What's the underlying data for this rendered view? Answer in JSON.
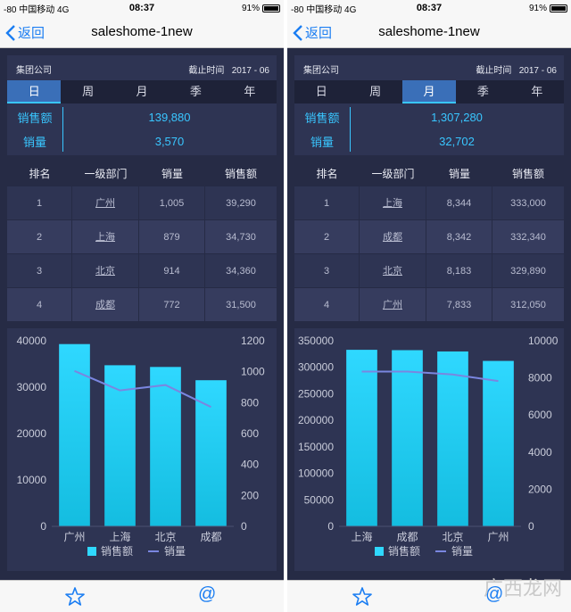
{
  "status_bar": {
    "carrier": "-80 中国移动",
    "network": "4G",
    "time": "08:37",
    "battery": "91%"
  },
  "nav": {
    "back_label": "返回",
    "title": "saleshome-1new"
  },
  "header": {
    "company": "集团公司",
    "deadline_label": "截止时间",
    "deadline_value": "2017 - 06"
  },
  "tabs": [
    "日",
    "周",
    "月",
    "季",
    "年"
  ],
  "metric_labels": {
    "sales_amount": "销售额",
    "sales_volume": "销量"
  },
  "table_headers": [
    "排名",
    "一级部门",
    "销量",
    "销售额"
  ],
  "legend": {
    "bar": "销售额",
    "line": "销量"
  },
  "colors": {
    "background": "#262b45",
    "card": "#2e3453",
    "accent": "#39c6ff",
    "active_tab": "#3a6fb8",
    "line": "#7a86e0"
  },
  "icons": {
    "back": "chevron-left-icon",
    "favorite": "star-icon",
    "mention": "at-icon"
  },
  "panels": [
    {
      "active_tab": "日",
      "sales_amount": "139,880",
      "sales_volume": "3,570",
      "rows": [
        {
          "rank": "1",
          "dept": "广州",
          "volume": "1,005",
          "amount": "39,290"
        },
        {
          "rank": "2",
          "dept": "上海",
          "volume": "879",
          "amount": "34,730"
        },
        {
          "rank": "3",
          "dept": "北京",
          "volume": "914",
          "amount": "34,360"
        },
        {
          "rank": "4",
          "dept": "成都",
          "volume": "772",
          "amount": "31,500"
        }
      ],
      "chart_data": {
        "type": "bar",
        "categories": [
          "广州",
          "上海",
          "北京",
          "成都"
        ],
        "series": [
          {
            "name": "销售额",
            "type": "bar",
            "axis": "left",
            "values": [
              39290,
              34730,
              34360,
              31500
            ]
          },
          {
            "name": "销量",
            "type": "line",
            "axis": "right",
            "values": [
              1005,
              879,
              914,
              772
            ]
          }
        ],
        "y_left": {
          "min": 0,
          "max": 40000,
          "ticks": [
            "0",
            "10000",
            "20000",
            "30000",
            "40000"
          ]
        },
        "y_right": {
          "min": 0,
          "max": 1200,
          "ticks": [
            "0",
            "200",
            "400",
            "600",
            "800",
            "1000",
            "1200"
          ]
        },
        "legend_position": "bottom"
      }
    },
    {
      "active_tab": "月",
      "sales_amount": "1,307,280",
      "sales_volume": "32,702",
      "rows": [
        {
          "rank": "1",
          "dept": "上海",
          "volume": "8,344",
          "amount": "333,000"
        },
        {
          "rank": "2",
          "dept": "成都",
          "volume": "8,342",
          "amount": "332,340"
        },
        {
          "rank": "3",
          "dept": "北京",
          "volume": "8,183",
          "amount": "329,890"
        },
        {
          "rank": "4",
          "dept": "广州",
          "volume": "7,833",
          "amount": "312,050"
        }
      ],
      "chart_data": {
        "type": "bar",
        "categories": [
          "上海",
          "成都",
          "北京",
          "广州"
        ],
        "series": [
          {
            "name": "销售额",
            "type": "bar",
            "axis": "left",
            "values": [
              333000,
              332340,
              329890,
              312050
            ]
          },
          {
            "name": "销量",
            "type": "line",
            "axis": "right",
            "values": [
              8344,
              8342,
              8183,
              7833
            ]
          }
        ],
        "y_left": {
          "min": 0,
          "max": 350000,
          "ticks": [
            "0",
            "50000",
            "100000",
            "150000",
            "200000",
            "250000",
            "300000",
            "350000"
          ]
        },
        "y_right": {
          "min": 0,
          "max": 10000,
          "ticks": [
            "0",
            "2000",
            "4000",
            "6000",
            "8000",
            "10000"
          ]
        },
        "legend_position": "bottom"
      }
    }
  ],
  "watermark": "广西龙网"
}
